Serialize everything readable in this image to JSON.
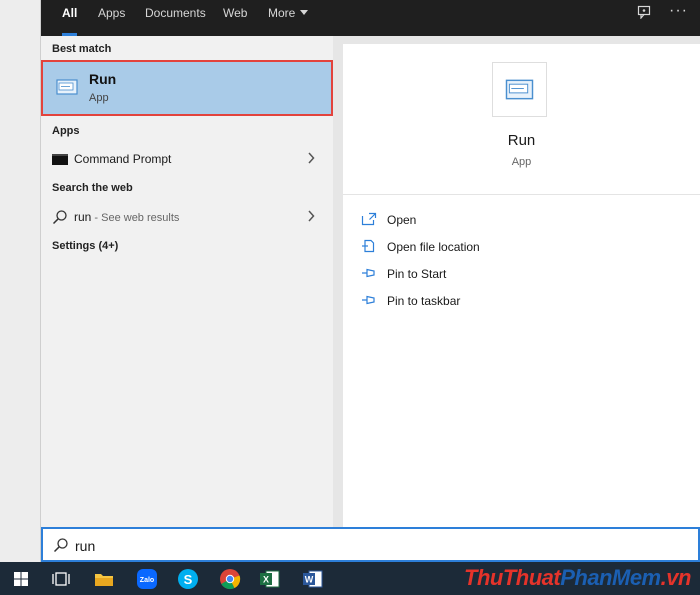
{
  "tabs": [
    {
      "label": "All",
      "active": true
    },
    {
      "label": "Apps"
    },
    {
      "label": "Documents"
    },
    {
      "label": "Web"
    },
    {
      "label": "More"
    }
  ],
  "topbar_icons": [
    "feedback-icon",
    "more-options-icon"
  ],
  "results": {
    "best_match_heading": "Best match",
    "best_match": {
      "title": "Run",
      "subtitle": "App",
      "icon": "run-app-icon"
    },
    "apps_heading": "Apps",
    "apps": [
      {
        "label": "Command Prompt",
        "icon": "command-prompt-icon"
      }
    ],
    "web_heading": "Search the web",
    "web": {
      "query": "run",
      "hint": " - See web results"
    },
    "settings_heading": "Settings (4+)"
  },
  "detail": {
    "title": "Run",
    "subtitle": "App",
    "actions": [
      {
        "label": "Open",
        "icon": "open-icon"
      },
      {
        "label": "Open file location",
        "icon": "file-location-icon"
      },
      {
        "label": "Pin to Start",
        "icon": "pin-icon"
      },
      {
        "label": "Pin to taskbar",
        "icon": "pin-icon"
      }
    ]
  },
  "search": {
    "value": "run"
  },
  "taskbar": {
    "items": [
      "windows-start-icon",
      "task-view-icon",
      "file-explorer-icon",
      "zalo-icon",
      "skype-icon",
      "chrome-icon",
      "excel-icon",
      "word-icon"
    ],
    "zalo_label": "Zalo"
  },
  "watermark": {
    "part1": "ThuThuat",
    "part2": "PhanMem",
    "part3": ".vn"
  },
  "colors": {
    "accent": "#2d7fd9",
    "highlight": "#a9cbe8",
    "highlight_border": "#e3433c",
    "topbar": "#1f1f1f",
    "taskbar": "#1c2a38"
  }
}
